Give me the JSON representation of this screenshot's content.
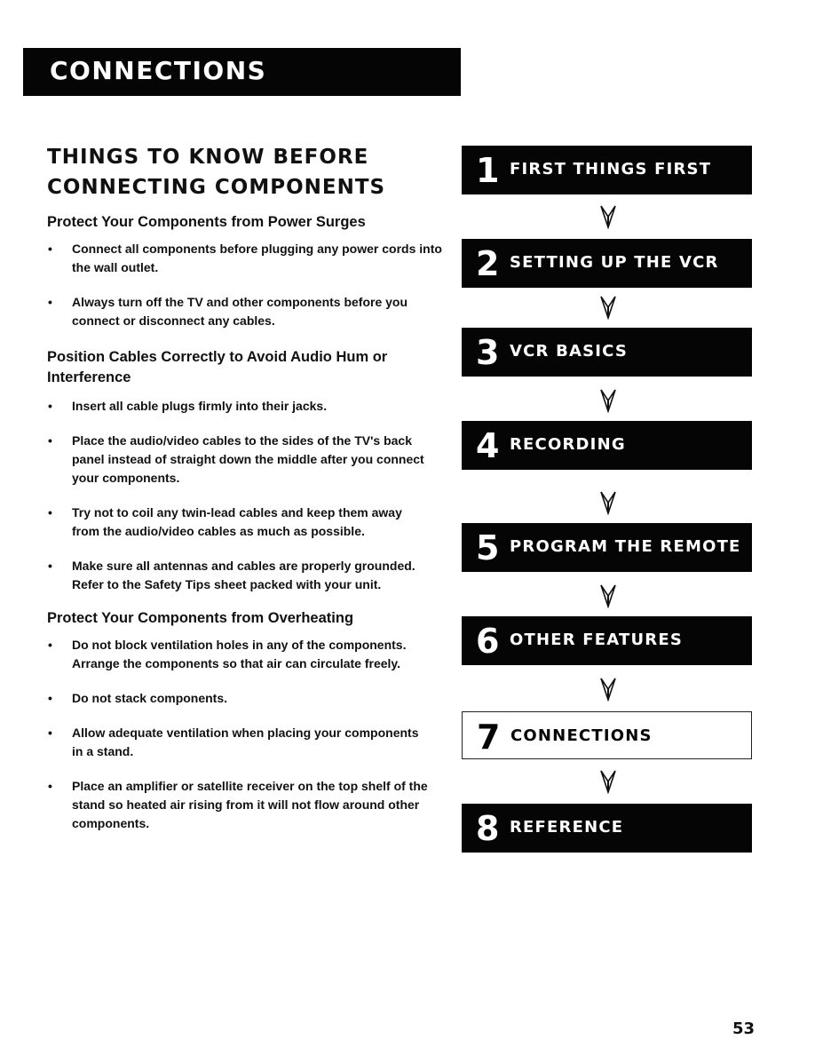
{
  "header": {
    "title": "CONNECTIONS"
  },
  "main": {
    "title_line1": "THINGS TO KNOW BEFORE",
    "title_line2": "CONNECTING COMPONENTS",
    "sections": [
      {
        "heading": "Protect Your Components from Power Surges",
        "bullets": [
          "Connect all components before plugging any power cords into the wall outlet.",
          "Always turn off the TV and other components before you connect or disconnect any cables."
        ]
      },
      {
        "heading": "Position Cables Correctly to Avoid Audio Hum or Interference",
        "bullets": [
          "Insert all cable plugs firmly into their jacks.",
          "Place the audio/video cables to the sides of the TV's back panel instead of straight down the middle after you connect your components.",
          "Try not to coil any twin-lead cables and keep them away from the audio/video cables as much as possible.",
          "Make sure all antennas and cables are properly grounded. Refer to the Safety Tips sheet packed with your unit."
        ]
      },
      {
        "heading": "Protect Your Components from Overheating",
        "bullets": [
          "Do not block ventilation holes in any of the components. Arrange the components so that air can circulate freely.",
          "Do not stack components.",
          "Allow adequate ventilation when placing your components in a stand.",
          "Place an amplifier or satellite receiver on the top shelf of the stand so heated air rising from it will not flow around other components."
        ]
      }
    ],
    "bullet_char": "•"
  },
  "chapters": [
    {
      "number": "1",
      "label": "FIRST THINGS FIRST",
      "current": false
    },
    {
      "number": "2",
      "label": "SETTING UP THE VCR",
      "current": false
    },
    {
      "number": "3",
      "label": "VCR BASICS",
      "current": false
    },
    {
      "number": "4",
      "label": "RECORDING",
      "current": false
    },
    {
      "number": "5",
      "label": "PROGRAM THE REMOTE",
      "current": false
    },
    {
      "number": "6",
      "label": "OTHER FEATURES",
      "current": false
    },
    {
      "number": "7",
      "label": "CONNECTIONS",
      "current": true
    },
    {
      "number": "8",
      "label": "REFERENCE",
      "current": false
    }
  ],
  "colors": {
    "ink": "#050505",
    "paper": "#ffffff"
  },
  "footer": {
    "page_number": "53"
  }
}
